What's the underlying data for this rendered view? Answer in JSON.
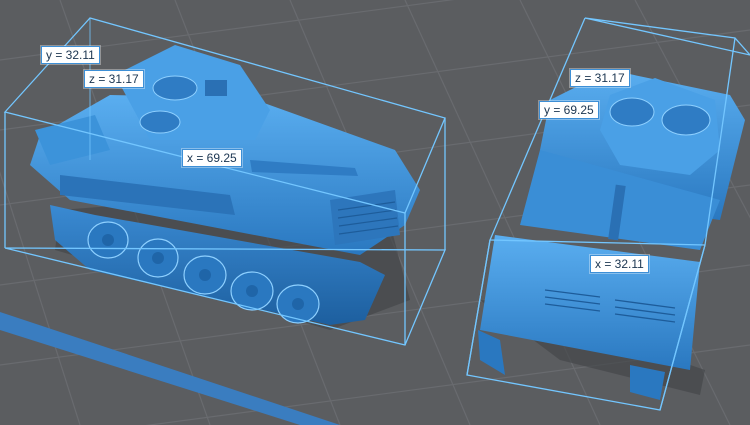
{
  "viewport": {
    "background_color": "#5b5d60",
    "grid_color": "#6a6c70",
    "bed_edge_color": "#3e7fc0",
    "bbox_color": "#6fc2ff",
    "model_color": "#3b8fd6"
  },
  "models": [
    {
      "name": "tank-side-view",
      "dims": {
        "x": "x = 69.25",
        "y": "y = 32.11",
        "z": "z = 31.17"
      }
    },
    {
      "name": "tank-rear-view",
      "dims": {
        "x": "x = 32.11",
        "y": "y = 69.25",
        "z": "z = 31.17"
      }
    }
  ]
}
